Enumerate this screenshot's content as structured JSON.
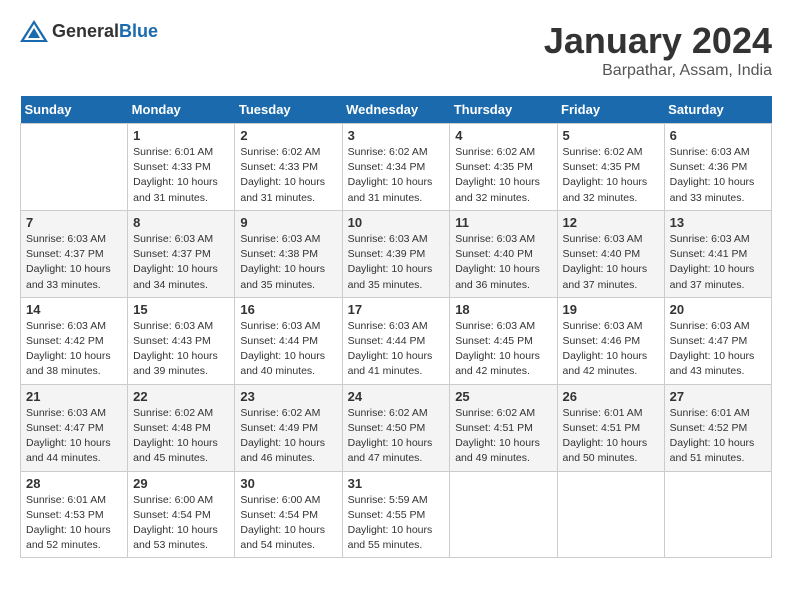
{
  "header": {
    "logo_general": "General",
    "logo_blue": "Blue",
    "month": "January 2024",
    "location": "Barpathar, Assam, India"
  },
  "days_of_week": [
    "Sunday",
    "Monday",
    "Tuesday",
    "Wednesday",
    "Thursday",
    "Friday",
    "Saturday"
  ],
  "weeks": [
    [
      {
        "day": "",
        "info": ""
      },
      {
        "day": "1",
        "info": "Sunrise: 6:01 AM\nSunset: 4:33 PM\nDaylight: 10 hours\nand 31 minutes."
      },
      {
        "day": "2",
        "info": "Sunrise: 6:02 AM\nSunset: 4:33 PM\nDaylight: 10 hours\nand 31 minutes."
      },
      {
        "day": "3",
        "info": "Sunrise: 6:02 AM\nSunset: 4:34 PM\nDaylight: 10 hours\nand 31 minutes."
      },
      {
        "day": "4",
        "info": "Sunrise: 6:02 AM\nSunset: 4:35 PM\nDaylight: 10 hours\nand 32 minutes."
      },
      {
        "day": "5",
        "info": "Sunrise: 6:02 AM\nSunset: 4:35 PM\nDaylight: 10 hours\nand 32 minutes."
      },
      {
        "day": "6",
        "info": "Sunrise: 6:03 AM\nSunset: 4:36 PM\nDaylight: 10 hours\nand 33 minutes."
      }
    ],
    [
      {
        "day": "7",
        "info": "Sunrise: 6:03 AM\nSunset: 4:37 PM\nDaylight: 10 hours\nand 33 minutes."
      },
      {
        "day": "8",
        "info": "Sunrise: 6:03 AM\nSunset: 4:37 PM\nDaylight: 10 hours\nand 34 minutes."
      },
      {
        "day": "9",
        "info": "Sunrise: 6:03 AM\nSunset: 4:38 PM\nDaylight: 10 hours\nand 35 minutes."
      },
      {
        "day": "10",
        "info": "Sunrise: 6:03 AM\nSunset: 4:39 PM\nDaylight: 10 hours\nand 35 minutes."
      },
      {
        "day": "11",
        "info": "Sunrise: 6:03 AM\nSunset: 4:40 PM\nDaylight: 10 hours\nand 36 minutes."
      },
      {
        "day": "12",
        "info": "Sunrise: 6:03 AM\nSunset: 4:40 PM\nDaylight: 10 hours\nand 37 minutes."
      },
      {
        "day": "13",
        "info": "Sunrise: 6:03 AM\nSunset: 4:41 PM\nDaylight: 10 hours\nand 37 minutes."
      }
    ],
    [
      {
        "day": "14",
        "info": "Sunrise: 6:03 AM\nSunset: 4:42 PM\nDaylight: 10 hours\nand 38 minutes."
      },
      {
        "day": "15",
        "info": "Sunrise: 6:03 AM\nSunset: 4:43 PM\nDaylight: 10 hours\nand 39 minutes."
      },
      {
        "day": "16",
        "info": "Sunrise: 6:03 AM\nSunset: 4:44 PM\nDaylight: 10 hours\nand 40 minutes."
      },
      {
        "day": "17",
        "info": "Sunrise: 6:03 AM\nSunset: 4:44 PM\nDaylight: 10 hours\nand 41 minutes."
      },
      {
        "day": "18",
        "info": "Sunrise: 6:03 AM\nSunset: 4:45 PM\nDaylight: 10 hours\nand 42 minutes."
      },
      {
        "day": "19",
        "info": "Sunrise: 6:03 AM\nSunset: 4:46 PM\nDaylight: 10 hours\nand 42 minutes."
      },
      {
        "day": "20",
        "info": "Sunrise: 6:03 AM\nSunset: 4:47 PM\nDaylight: 10 hours\nand 43 minutes."
      }
    ],
    [
      {
        "day": "21",
        "info": "Sunrise: 6:03 AM\nSunset: 4:47 PM\nDaylight: 10 hours\nand 44 minutes."
      },
      {
        "day": "22",
        "info": "Sunrise: 6:02 AM\nSunset: 4:48 PM\nDaylight: 10 hours\nand 45 minutes."
      },
      {
        "day": "23",
        "info": "Sunrise: 6:02 AM\nSunset: 4:49 PM\nDaylight: 10 hours\nand 46 minutes."
      },
      {
        "day": "24",
        "info": "Sunrise: 6:02 AM\nSunset: 4:50 PM\nDaylight: 10 hours\nand 47 minutes."
      },
      {
        "day": "25",
        "info": "Sunrise: 6:02 AM\nSunset: 4:51 PM\nDaylight: 10 hours\nand 49 minutes."
      },
      {
        "day": "26",
        "info": "Sunrise: 6:01 AM\nSunset: 4:51 PM\nDaylight: 10 hours\nand 50 minutes."
      },
      {
        "day": "27",
        "info": "Sunrise: 6:01 AM\nSunset: 4:52 PM\nDaylight: 10 hours\nand 51 minutes."
      }
    ],
    [
      {
        "day": "28",
        "info": "Sunrise: 6:01 AM\nSunset: 4:53 PM\nDaylight: 10 hours\nand 52 minutes."
      },
      {
        "day": "29",
        "info": "Sunrise: 6:00 AM\nSunset: 4:54 PM\nDaylight: 10 hours\nand 53 minutes."
      },
      {
        "day": "30",
        "info": "Sunrise: 6:00 AM\nSunset: 4:54 PM\nDaylight: 10 hours\nand 54 minutes."
      },
      {
        "day": "31",
        "info": "Sunrise: 5:59 AM\nSunset: 4:55 PM\nDaylight: 10 hours\nand 55 minutes."
      },
      {
        "day": "",
        "info": ""
      },
      {
        "day": "",
        "info": ""
      },
      {
        "day": "",
        "info": ""
      }
    ]
  ]
}
